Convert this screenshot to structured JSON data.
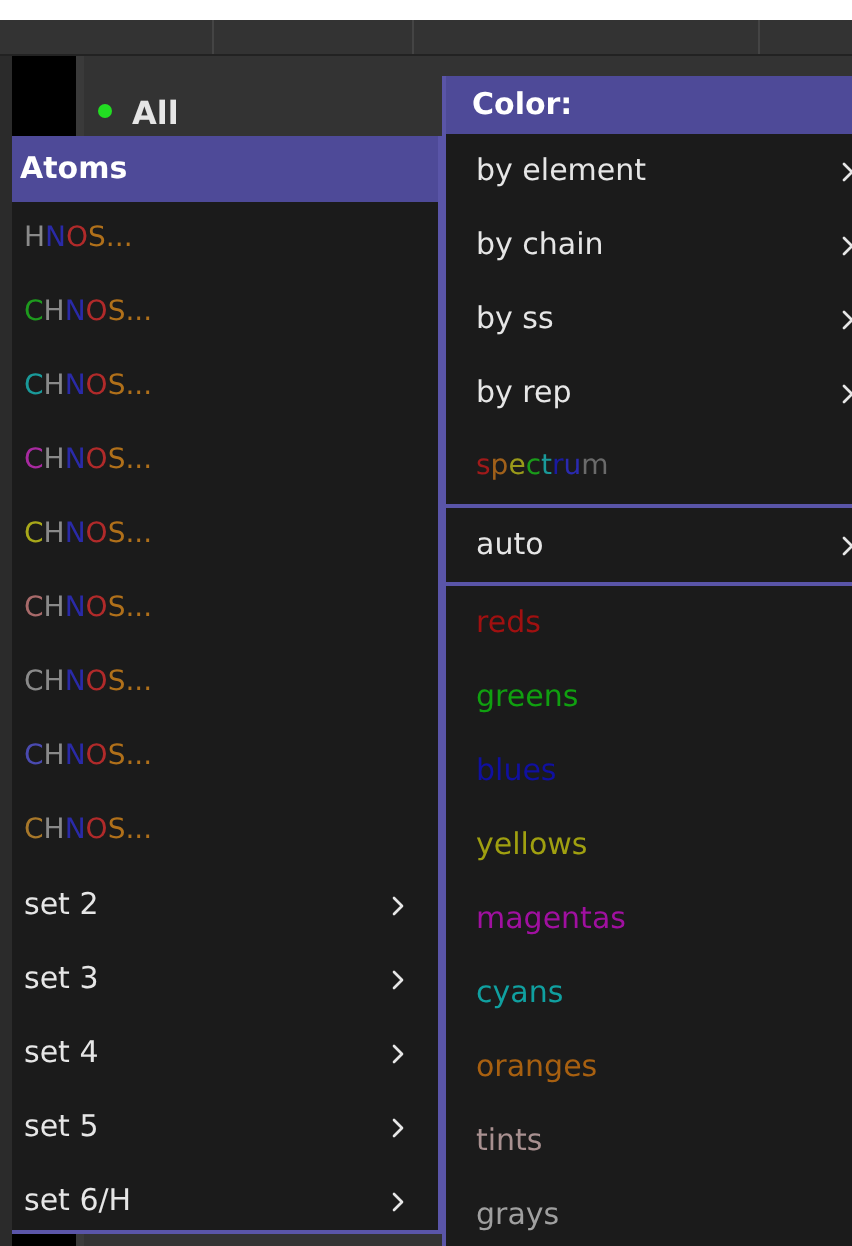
{
  "object_panel": {
    "entry": {
      "label": "All",
      "color": "#22dd22"
    }
  },
  "atoms_menu": {
    "title": "Atoms",
    "items": [
      {
        "kind": "elements",
        "segments": [
          {
            "text": "H",
            "color": "#8a8a8a"
          },
          {
            "text": "N",
            "color": "#2a2aa8"
          },
          {
            "text": "O",
            "color": "#b02a2a"
          },
          {
            "text": "S...",
            "color": "#b0701a"
          }
        ]
      },
      {
        "kind": "elements",
        "segments": [
          {
            "text": "C",
            "color": "#1e9a1e"
          },
          {
            "text": "H",
            "color": "#8a8a8a"
          },
          {
            "text": "N",
            "color": "#2a2aa8"
          },
          {
            "text": "O",
            "color": "#b02a2a"
          },
          {
            "text": "S...",
            "color": "#b0701a"
          }
        ]
      },
      {
        "kind": "elements",
        "segments": [
          {
            "text": "C",
            "color": "#1a9a9a"
          },
          {
            "text": "H",
            "color": "#8a8a8a"
          },
          {
            "text": "N",
            "color": "#2a2aa8"
          },
          {
            "text": "O",
            "color": "#b02a2a"
          },
          {
            "text": "S...",
            "color": "#b0701a"
          }
        ]
      },
      {
        "kind": "elements",
        "segments": [
          {
            "text": "C",
            "color": "#a82aa0"
          },
          {
            "text": "H",
            "color": "#8a8a8a"
          },
          {
            "text": "N",
            "color": "#2a2aa8"
          },
          {
            "text": "O",
            "color": "#b02a2a"
          },
          {
            "text": "S...",
            "color": "#b0701a"
          }
        ]
      },
      {
        "kind": "elements",
        "segments": [
          {
            "text": "C",
            "color": "#a8a81a"
          },
          {
            "text": "H",
            "color": "#8a8a8a"
          },
          {
            "text": "N",
            "color": "#2a2aa8"
          },
          {
            "text": "O",
            "color": "#b02a2a"
          },
          {
            "text": "S...",
            "color": "#b0701a"
          }
        ]
      },
      {
        "kind": "elements",
        "segments": [
          {
            "text": "C",
            "color": "#a86a6a"
          },
          {
            "text": "H",
            "color": "#8a8a8a"
          },
          {
            "text": "N",
            "color": "#2a2aa8"
          },
          {
            "text": "O",
            "color": "#b02a2a"
          },
          {
            "text": "S...",
            "color": "#b0701a"
          }
        ]
      },
      {
        "kind": "elements",
        "segments": [
          {
            "text": "C",
            "color": "#8a8a8a"
          },
          {
            "text": "H",
            "color": "#8a8a8a"
          },
          {
            "text": "N",
            "color": "#2a2aa8"
          },
          {
            "text": "O",
            "color": "#b02a2a"
          },
          {
            "text": "S...",
            "color": "#b0701a"
          }
        ]
      },
      {
        "kind": "elements",
        "segments": [
          {
            "text": "C",
            "color": "#4a4ab0"
          },
          {
            "text": "H",
            "color": "#8a8a8a"
          },
          {
            "text": "N",
            "color": "#2a2aa8"
          },
          {
            "text": "O",
            "color": "#b02a2a"
          },
          {
            "text": "S...",
            "color": "#b0701a"
          }
        ]
      },
      {
        "kind": "elements",
        "segments": [
          {
            "text": "C",
            "color": "#a8782a"
          },
          {
            "text": "H",
            "color": "#8a8a8a"
          },
          {
            "text": "N",
            "color": "#2a2aa8"
          },
          {
            "text": "O",
            "color": "#b02a2a"
          },
          {
            "text": "S...",
            "color": "#b0701a"
          }
        ]
      },
      {
        "kind": "submenu",
        "label": "set 2"
      },
      {
        "kind": "submenu",
        "label": "set 3"
      },
      {
        "kind": "submenu",
        "label": "set 4"
      },
      {
        "kind": "submenu",
        "label": "set 5"
      },
      {
        "kind": "submenu",
        "label": "set 6/H"
      }
    ]
  },
  "color_menu": {
    "title": "Color:",
    "items": [
      {
        "kind": "submenu",
        "label": "by element"
      },
      {
        "kind": "submenu",
        "label": "by chain"
      },
      {
        "kind": "submenu",
        "label": "by ss"
      },
      {
        "kind": "submenu",
        "label": "by rep"
      },
      {
        "kind": "elements",
        "segments": [
          {
            "text": "s",
            "color": "#a01a1a"
          },
          {
            "text": "p",
            "color": "#a0601a"
          },
          {
            "text": "e",
            "color": "#9a9a1a"
          },
          {
            "text": "c",
            "color": "#1a9a1a"
          },
          {
            "text": "t",
            "color": "#1a9a9a"
          },
          {
            "text": "r",
            "color": "#1a1aa0"
          },
          {
            "text": "u",
            "color": "#2a2ab0"
          },
          {
            "text": "m",
            "color": "#6a6a6a"
          }
        ]
      },
      {
        "kind": "separator"
      },
      {
        "kind": "submenu",
        "label": "auto"
      },
      {
        "kind": "separator"
      },
      {
        "kind": "colored",
        "label": "reds",
        "color": "#a01010"
      },
      {
        "kind": "colored",
        "label": "greens",
        "color": "#10a010"
      },
      {
        "kind": "colored",
        "label": "blues",
        "color": "#1010a0"
      },
      {
        "kind": "colored",
        "label": "yellows",
        "color": "#a0a010"
      },
      {
        "kind": "colored",
        "label": "magentas",
        "color": "#a010a0"
      },
      {
        "kind": "colored",
        "label": "cyans",
        "color": "#10a0a0"
      },
      {
        "kind": "colored",
        "label": "oranges",
        "color": "#a86010"
      },
      {
        "kind": "colored",
        "label": "tints",
        "color": "#a89090"
      },
      {
        "kind": "colored",
        "label": "grays",
        "color": "#a0a0a0"
      }
    ]
  }
}
